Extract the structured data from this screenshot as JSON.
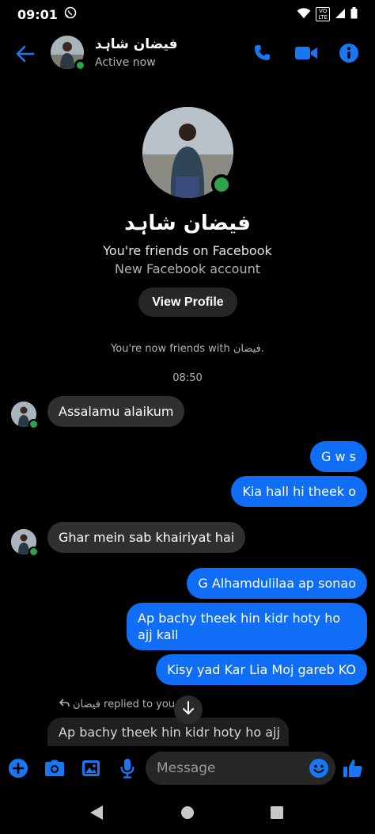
{
  "status_bar": {
    "time": "09:01",
    "lte": "VO\nLTE"
  },
  "header": {
    "name": "فیضان شاہد",
    "status": "Active now"
  },
  "profile": {
    "name": "فیضان شاہد",
    "friends_text": "You're friends on Facebook",
    "account_text": "New Facebook account",
    "view_profile_label": "View Profile"
  },
  "friends_note": "You're now friends with فیضان.",
  "timestamp": "08:50",
  "messages": [
    {
      "side": "in",
      "text": "Assalamu alaikum"
    },
    {
      "side": "out",
      "text": "G w s"
    },
    {
      "side": "out",
      "text": "Kia hall hi theek o"
    },
    {
      "side": "in",
      "text": "Ghar mein sab khairiyat hai"
    },
    {
      "side": "out",
      "text": "G Alhamdulilaa ap sonao"
    },
    {
      "side": "out",
      "text": "Ap bachy theek hin kidr hoty ho ajj kall"
    },
    {
      "side": "out",
      "text": "Kisy yad Kar Lia Moj gareb KO"
    }
  ],
  "reply": {
    "note": "فیضان replied to you",
    "preview": "Ap bachy theek hin kidr hoty ho ajj"
  },
  "composer": {
    "placeholder": "Message"
  },
  "colors": {
    "accent": "#0f6ef5",
    "online": "#31a24c",
    "incoming_bubble": "#303030",
    "background": "#000000"
  }
}
